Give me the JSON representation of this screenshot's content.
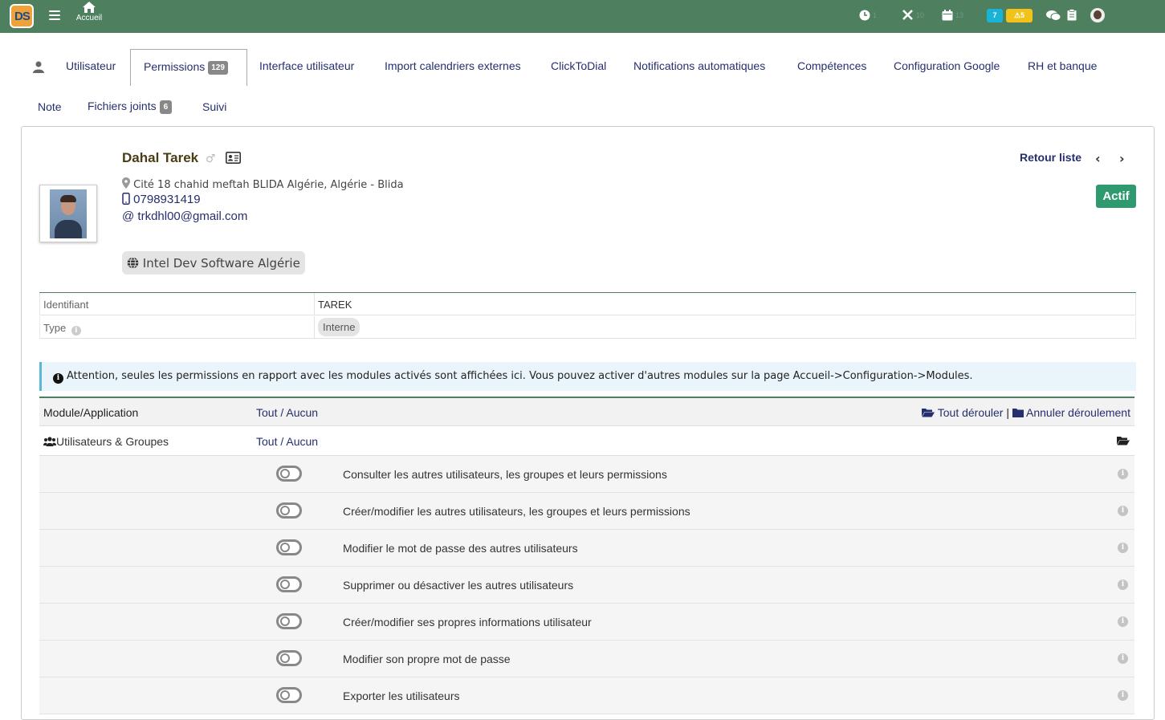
{
  "topbar": {
    "logo_text": "DS",
    "home_label": "Accueil",
    "counts": {
      "clock": "1",
      "tools": "10",
      "calendar": "13"
    },
    "badge_info": "7",
    "badge_warning": "5",
    "color_bar": "#4e8060"
  },
  "tabs": {
    "row1": [
      {
        "label": "Utilisateur"
      },
      {
        "label": "Permissions",
        "badge": "129"
      },
      {
        "label": "Interface utilisateur"
      },
      {
        "label": "Import calendriers externes"
      },
      {
        "label": "ClickToDial"
      },
      {
        "label": "Notifications automatiques"
      },
      {
        "label": "Compétences"
      },
      {
        "label": "Configuration Google"
      },
      {
        "label": "RH et banque"
      }
    ],
    "row2": [
      {
        "label": "Note"
      },
      {
        "label": "Fichiers joints",
        "badge": "6"
      },
      {
        "label": "Suivi"
      }
    ]
  },
  "profile": {
    "name": "Dahal Tarek",
    "address": "Cité 18 chahid meftah BLIDA Algérie, Algérie - Blida",
    "phone": "0798931419",
    "email": "trkdhl00@gmail.com",
    "company": "Intel Dev Software Algérie",
    "status": "Actif",
    "back_label": "Retour liste"
  },
  "info_table": [
    {
      "key": "Identifiant",
      "value": "TAREK"
    },
    {
      "key": "Type",
      "value": "Interne"
    }
  ],
  "alert": "Attention, seules les permissions en rapport avec les modules activés sont affichées ici. Vous pouvez activer d'autres modules sur la page Accueil->Configuration->Modules.",
  "permissions": {
    "head_module": "Module/Application",
    "head_all": "Tout / Aucun",
    "expand_all": "Tout dérouler",
    "collapse_all": "Annuler déroulement",
    "group_name": "Utilisateurs & Groupes",
    "group_all": "Tout / Aucun",
    "items": [
      {
        "label": "Consulter les autres utilisateurs, les groupes et leurs permissions",
        "enabled": false
      },
      {
        "label": "Créer/modifier les autres utilisateurs, les groupes et leurs permissions",
        "enabled": false
      },
      {
        "label": "Modifier le mot de passe des autres utilisateurs",
        "enabled": false
      },
      {
        "label": "Supprimer ou désactiver les autres utilisateurs",
        "enabled": false
      },
      {
        "label": "Créer/modifier ses propres informations utilisateur",
        "enabled": false
      },
      {
        "label": "Modifier son propre mot de passe",
        "enabled": false
      },
      {
        "label": "Exporter les utilisateurs",
        "enabled": false
      }
    ]
  }
}
